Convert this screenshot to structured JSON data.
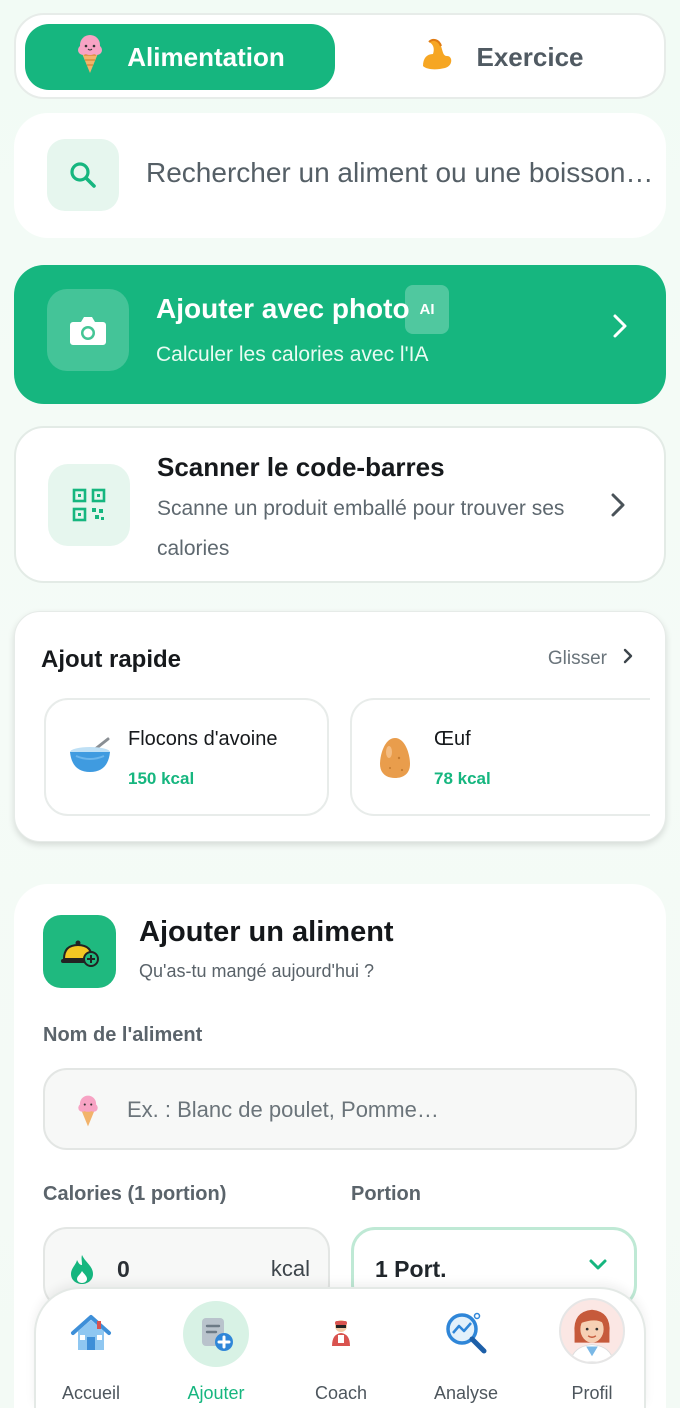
{
  "toggle": {
    "food_label": "Alimentation",
    "exercise_label": "Exercice"
  },
  "search": {
    "placeholder": "Rechercher un aliment ou une boisson…"
  },
  "photo_card": {
    "title": "Ajouter avec photo",
    "badge": "AI",
    "subtitle": "Calculer les calories avec l'IA"
  },
  "scan_card": {
    "title": "Scanner le code-barres",
    "subtitle": "Scanne un produit emballé pour trouver ses calories"
  },
  "quick_add": {
    "title": "Ajout rapide",
    "swipe_label": "Glisser",
    "items": [
      {
        "name": "Flocons d'avoine",
        "kcal": "150 kcal",
        "icon": "bowl-icon"
      },
      {
        "name": "Œuf",
        "kcal": "78 kcal",
        "icon": "egg-icon"
      }
    ]
  },
  "add_food": {
    "title": "Ajouter un aliment",
    "subtitle": "Qu'as-tu mangé aujourd'hui ?",
    "name_label": "Nom de l'aliment",
    "name_placeholder": "Ex. : Blanc de poulet, Pomme…",
    "calories_label": "Calories (1 portion)",
    "calories_value": "0",
    "calories_unit": "kcal",
    "portion_label": "Portion",
    "portion_value": "1 Port."
  },
  "nav": {
    "items": [
      {
        "label": "Accueil",
        "icon": "home-icon"
      },
      {
        "label": "Ajouter",
        "icon": "add-note-icon"
      },
      {
        "label": "Coach",
        "icon": "coach-icon"
      },
      {
        "label": "Analyse",
        "icon": "analytics-icon"
      },
      {
        "label": "Profil",
        "icon": "profile-icon"
      }
    ],
    "active": "Ajouter"
  },
  "colors": {
    "accent": "#16b67f",
    "accent_light": "#e6f6ee",
    "background": "#f2fbf5"
  }
}
